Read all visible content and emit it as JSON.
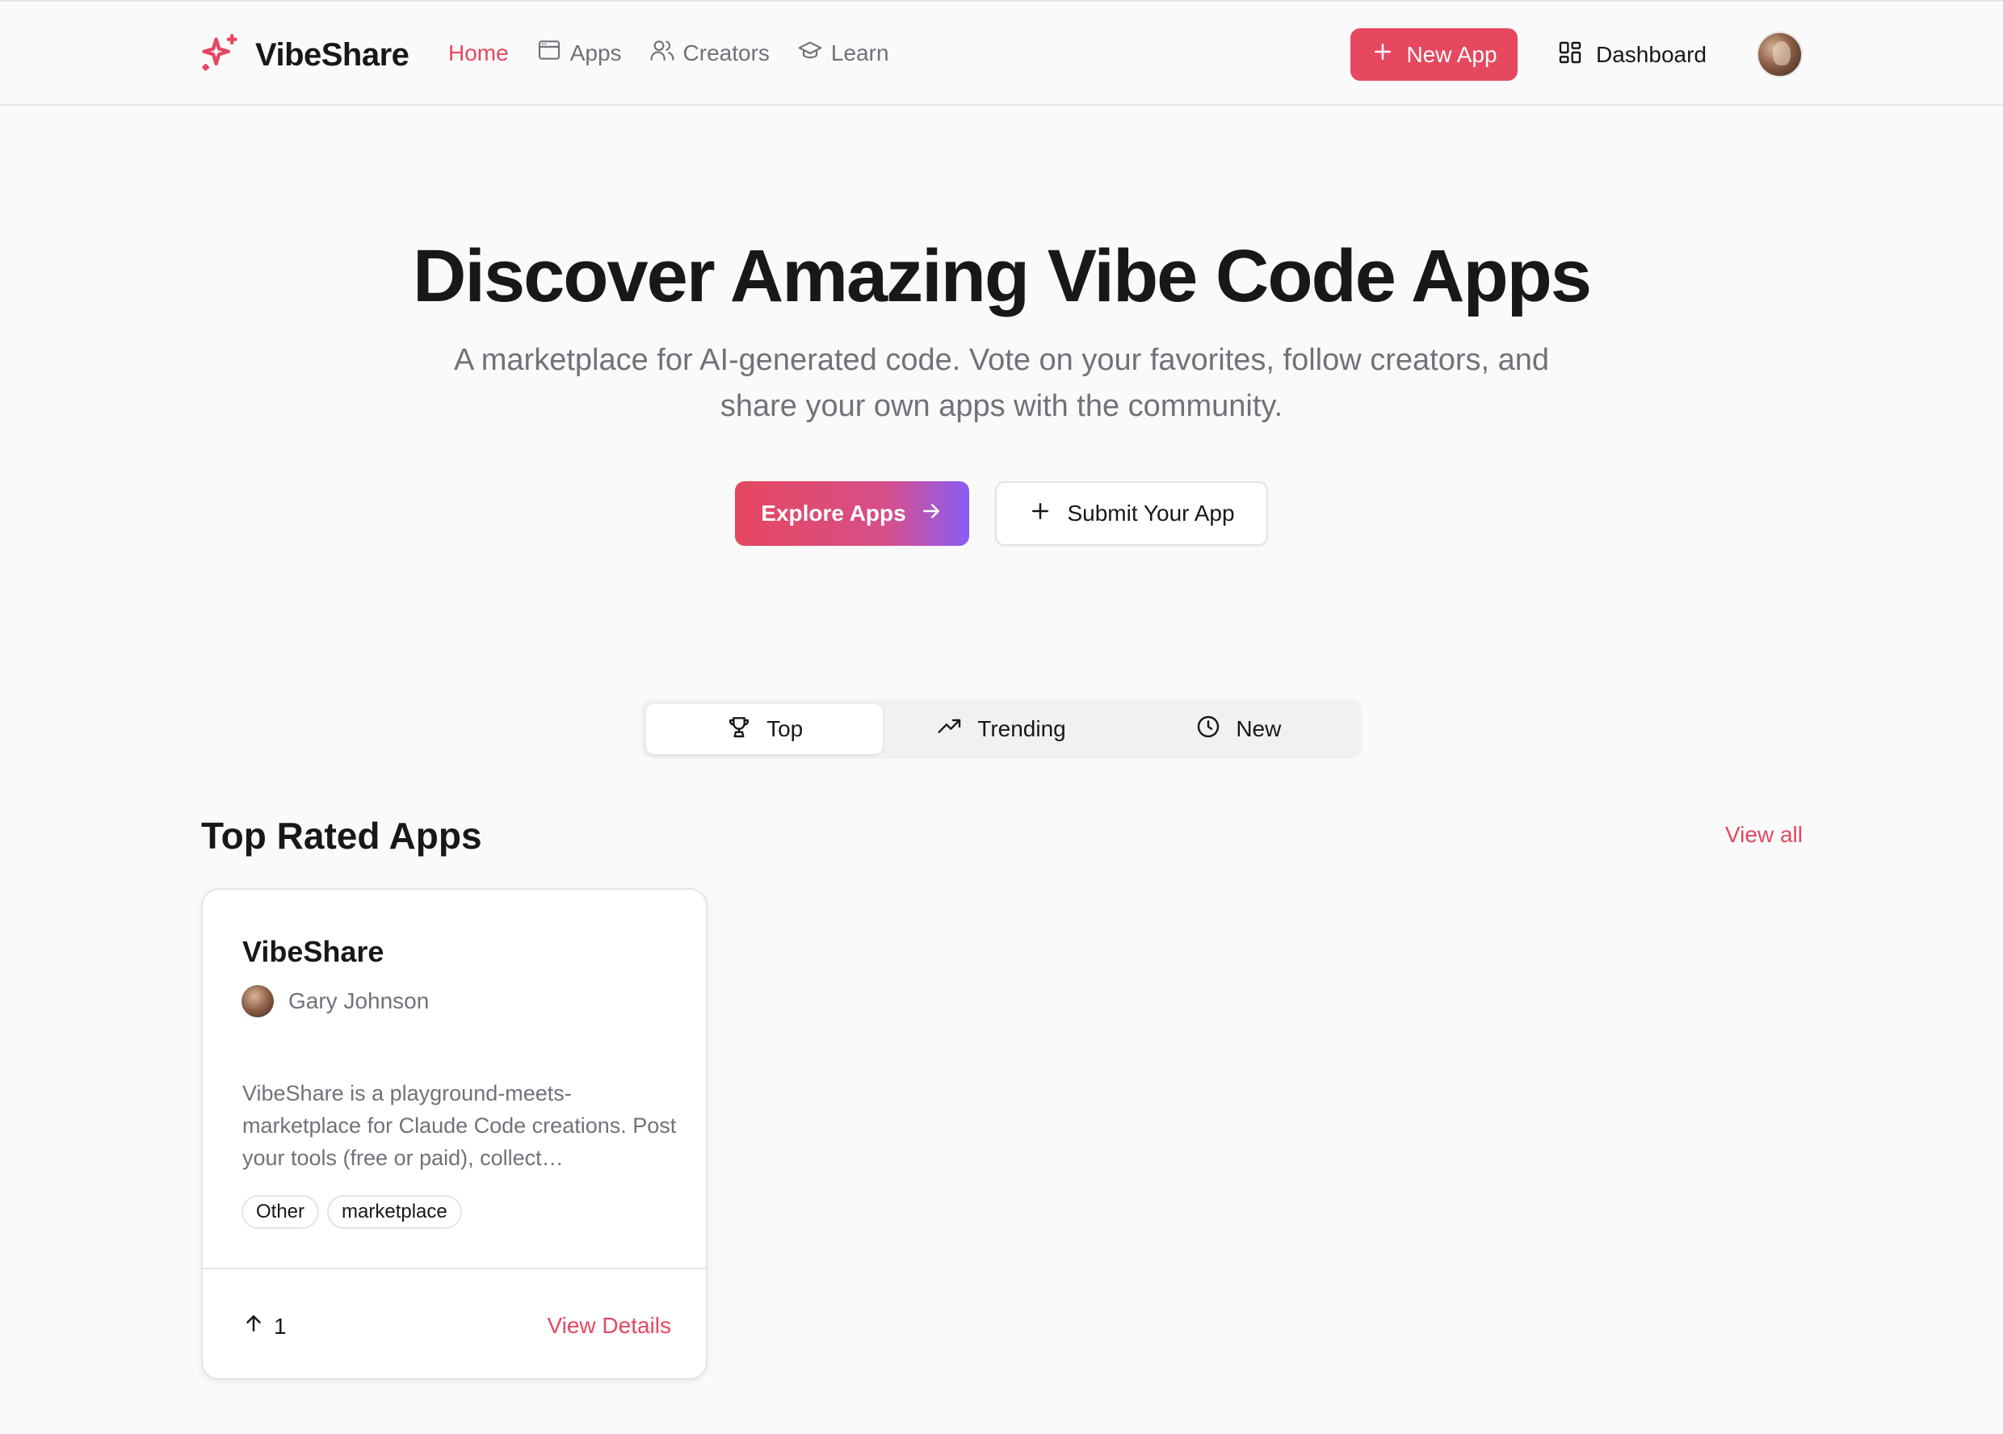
{
  "brand": {
    "name": "VibeShare",
    "accent": "#e5485f",
    "icon": "sparkles-icon"
  },
  "nav": {
    "items": [
      {
        "label": "Home",
        "icon": "home",
        "active": true
      },
      {
        "label": "Apps",
        "icon": "browser-window-icon",
        "active": false
      },
      {
        "label": "Creators",
        "icon": "users-icon",
        "active": false
      },
      {
        "label": "Learn",
        "icon": "graduation-cap-icon",
        "active": false
      }
    ],
    "new_app_label": "New App",
    "dashboard_label": "Dashboard"
  },
  "hero": {
    "title": "Discover Amazing Vibe Code Apps",
    "subtitle": "A marketplace for AI-generated code. Vote on your favorites, follow creators, and share your own apps with the community.",
    "explore_label": "Explore Apps",
    "submit_label": "Submit Your App"
  },
  "tabs": [
    {
      "label": "Top",
      "icon": "trophy-icon",
      "active": true
    },
    {
      "label": "Trending",
      "icon": "trending-up-icon",
      "active": false
    },
    {
      "label": "New",
      "icon": "clock-icon",
      "active": false
    }
  ],
  "section": {
    "title": "Top Rated Apps",
    "view_all_label": "View all"
  },
  "apps": [
    {
      "title": "VibeShare",
      "author": "Gary Johnson",
      "description": "VibeShare is a playground-meets-marketplace for Claude Code creations. Post your tools (free or paid), collect…",
      "tags": [
        "Other",
        "marketplace"
      ],
      "votes": "1",
      "details_label": "View Details"
    }
  ]
}
